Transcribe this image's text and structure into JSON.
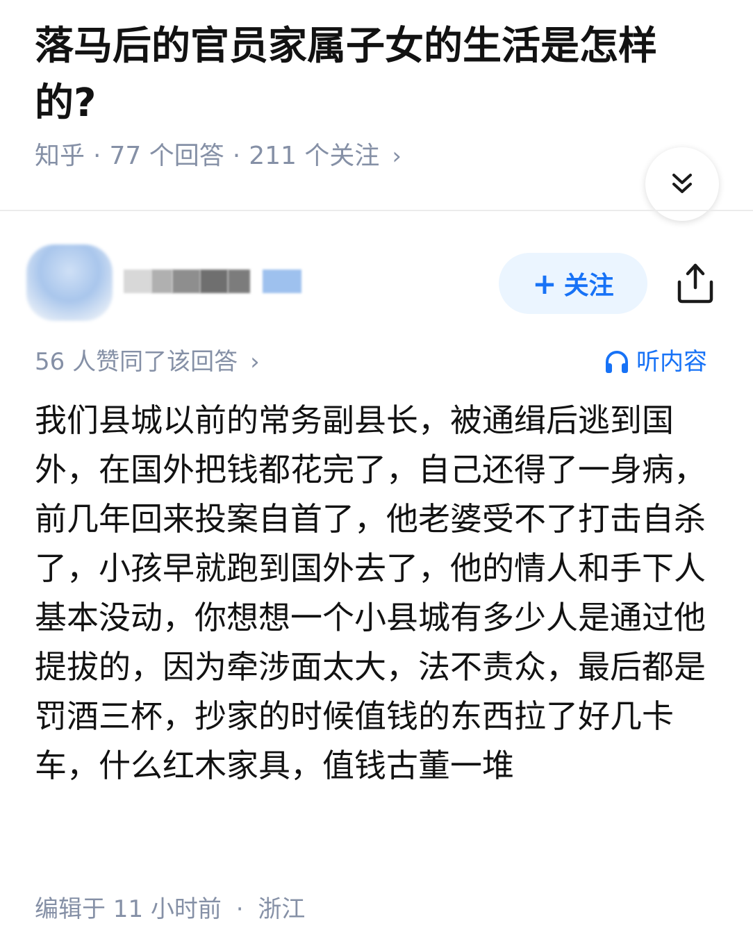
{
  "question": {
    "title": "落马后的官员家属子女的生活是怎样的?",
    "source": "知乎",
    "answers": "77 个回答",
    "followers": "211 个关注",
    "separator": "·",
    "chevron": "›"
  },
  "icons": {
    "collapse": "double-chevron-down-icon",
    "share": "share-icon",
    "listen": "headphones-icon"
  },
  "answer": {
    "follow_label": "关注",
    "follow_plus": "+",
    "vote_text": "56 人赞同了该回答",
    "vote_chevron": "›",
    "listen_label": "听内容",
    "body": "我们县城以前的常务副县长，被通缉后逃到国外，在国外把钱都花完了，自己还得了一身病，前几年回来投案自首了，他老婆受不了打击自杀了，小孩早就跑到国外去了，他的情人和手下人基本没动，你想想一个小县城有多少人是通过他提拔的，因为牵涉面太大，法不责众，最后都是罚酒三杯，抄家的时候值钱的东西拉了好几卡车，什么红木家具，值钱古董一堆",
    "edited": "编辑于 11 小时前",
    "separator": "·",
    "location": "浙江"
  },
  "colors": {
    "accent": "#1772f6",
    "accent_bg": "#ebf5ff",
    "meta_gray": "#8590a6",
    "text": "#121212"
  }
}
